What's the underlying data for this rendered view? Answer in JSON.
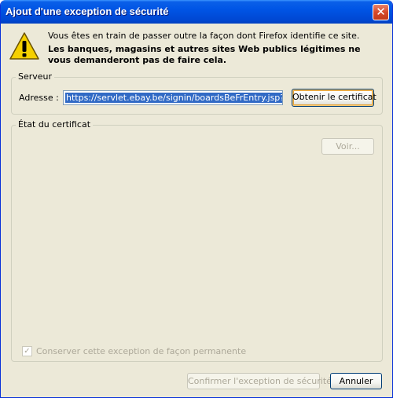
{
  "window": {
    "title": "Ajout d'une exception de sécurité",
    "close_glyph": "✕"
  },
  "message": {
    "line1": "Vous êtes en train de passer outre la façon dont Firefox identifie ce site.",
    "line2": "Les banques, magasins et autres sites Web publics légitimes ne vous demanderont pas de faire cela."
  },
  "server": {
    "legend": "Serveur",
    "address_label": "Adresse :",
    "address_value": "https://servlet.ebay.be/signin/boardsBeFrEntry.jsp?ebay",
    "get_cert_label": "Obtenir le certificat"
  },
  "certificate": {
    "legend": "État du certificat",
    "view_label": "Voir..."
  },
  "permanent": {
    "label": "Conserver cette exception de façon permanente",
    "checked": true
  },
  "buttons": {
    "confirm": "Confirmer l'exception de sécurité",
    "cancel": "Annuler"
  },
  "colors": {
    "titlebar": "#0055e5",
    "dialog_bg": "#ece9d8",
    "selection": "#316ac5",
    "warning": "#f5d000"
  },
  "icons": {
    "warning": "warning-icon",
    "close": "close-icon"
  }
}
